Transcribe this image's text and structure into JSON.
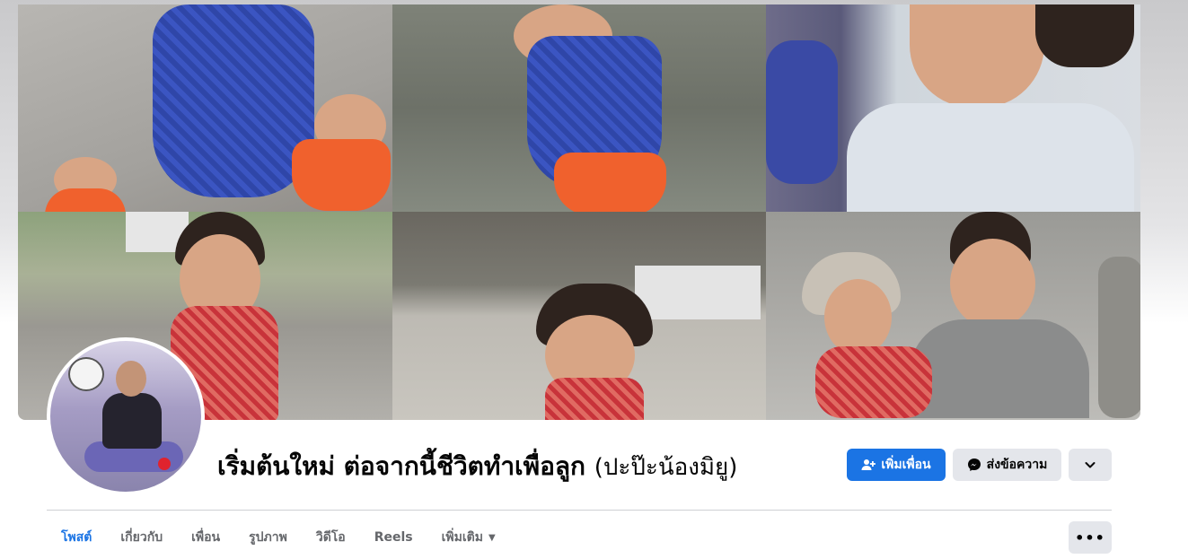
{
  "profile": {
    "name": "เริ่มต้นใหม่ ต่อจากนี้ชีวิตทำเพื่อลูก",
    "nickname": "(ปะป๊ะน้องมิยู)"
  },
  "actions": {
    "add_friend": "เพิ่มเพื่อน",
    "message": "ส่งข้อความ"
  },
  "tabs": [
    {
      "label": "โพสต์",
      "active": true
    },
    {
      "label": "เกี่ยวกับ",
      "active": false
    },
    {
      "label": "เพื่อน",
      "active": false
    },
    {
      "label": "รูปภาพ",
      "active": false
    },
    {
      "label": "วิดีโอ",
      "active": false
    },
    {
      "label": "Reels",
      "active": false
    },
    {
      "label": "เพิ่มเติม",
      "active": false
    }
  ],
  "colors": {
    "accent": "#1b74e4",
    "button_secondary": "#e4e6eb",
    "tab_inactive": "#65676b"
  },
  "icons": {
    "add_friend": "person-plus-icon",
    "message": "messenger-icon",
    "dropdown": "chevron-down-icon",
    "more": "ellipsis-icon",
    "tab_more": "caret-down-icon"
  }
}
